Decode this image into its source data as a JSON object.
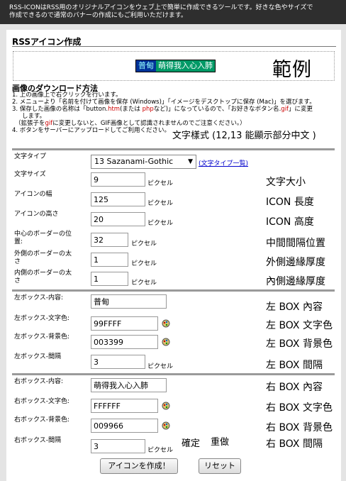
{
  "header": {
    "line1": "RSS-ICONはRSS用のオリジナルアイコンをウェブ上で簡単に作成できるツールです。好きな色やサイズで",
    "line2": "作成できるので通常のバナーの作成にもご利用いただけます。"
  },
  "section_title": "RSSアイコン作成",
  "example": {
    "left_text": "普甸",
    "right_text": "萌得我入心入肺",
    "left_bg": "#003399",
    "left_fg": "#99FFFF",
    "right_bg": "#009966",
    "right_fg": "#FFFFFF",
    "label": "範例"
  },
  "download": {
    "title": "画像のダウンロード方法",
    "step1": "1. 上の画像上で右クリックを行います。",
    "step2": "2. メニューより「名前を付けて画像を保存 (Windows)」「イメージをデスクトップに保存 (Mac)」を選びます。",
    "step3a": "3. 保存した画像の名称は「button.",
    "step3_htm": "htm",
    "step3b": "(または ",
    "step3_php": "php",
    "step3c": "など)」になっているので、「お好きなボタン名.",
    "step3_gif": "gif",
    "step3d": "」に変更",
    "step3e": "します。",
    "step4a": "（拡張子を",
    "step4_gif": "gif",
    "step4b": "に変更しないと、GIF画像として認識されませんのでご注意ください。）",
    "step5": "4. ボタンをサーバーにアップロードしてご利用ください。",
    "style_note": "文字樣式 (12,13 能顯示部分中文 )"
  },
  "form": {
    "font_type_label": "文字タイプ",
    "font_type_value": "13 Sazanami-Gothic",
    "font_list_link": "(文字タイプ一覧)",
    "font_size_label": "文字サイズ",
    "font_size_value": "9",
    "font_size_note": "文字大小",
    "icon_width_label": "アイコンの幅",
    "icon_width_value": "125",
    "icon_width_note": "ICON 長度",
    "icon_height_label": "アイコンの高さ",
    "icon_height_value": "20",
    "icon_height_note": "ICON 高度",
    "center_border_label1": "中心のボーダーの位",
    "center_border_label2": "置:",
    "center_border_value": "32",
    "center_border_note": "中間間隔位置",
    "outer_border_label1": "外側のボーダーの太",
    "outer_border_label2": "さ",
    "outer_border_value": "1",
    "outer_border_note": "外側邊緣厚度",
    "inner_border_label1": "内側のボーダーの太",
    "inner_border_label2": "さ",
    "inner_border_value": "1",
    "inner_border_note": "內側邊緣厚度",
    "pixel_unit": "ピクセル",
    "left_content_label": "左ボックス-内容:",
    "left_content_value": "普甸",
    "left_content_note": "左 BOX 內容",
    "left_fg_label": "左ボックス-文字色:",
    "left_fg_value": "99FFFF",
    "left_fg_note": "左 BOX 文字色",
    "left_bg_label": "左ボックス-背景色:",
    "left_bg_value": "003399",
    "left_bg_note": "左 BOX 背景色",
    "left_gap_label": "左ボックス-間隔",
    "left_gap_value": "3",
    "left_gap_note": "左 BOX 間隔",
    "right_content_label": "右ボックス-内容:",
    "right_content_value": "萌得我入心入肺",
    "right_content_note": "右 BOX 內容",
    "right_fg_label": "右ボックス-文字色:",
    "right_fg_value": "FFFFFF",
    "right_fg_note": "右 BOX 文字色",
    "right_bg_label": "右ボックス-背景色:",
    "right_bg_value": "009966",
    "right_bg_note": "右 BOX 背景色",
    "right_gap_label": "右ボックス-間隔",
    "right_gap_value": "3",
    "right_gap_note": "右 BOX 間隔",
    "confirm_note": "確定",
    "redo_note": "重做",
    "create_button": "アイコンを作成！",
    "reset_button": "リセット"
  }
}
